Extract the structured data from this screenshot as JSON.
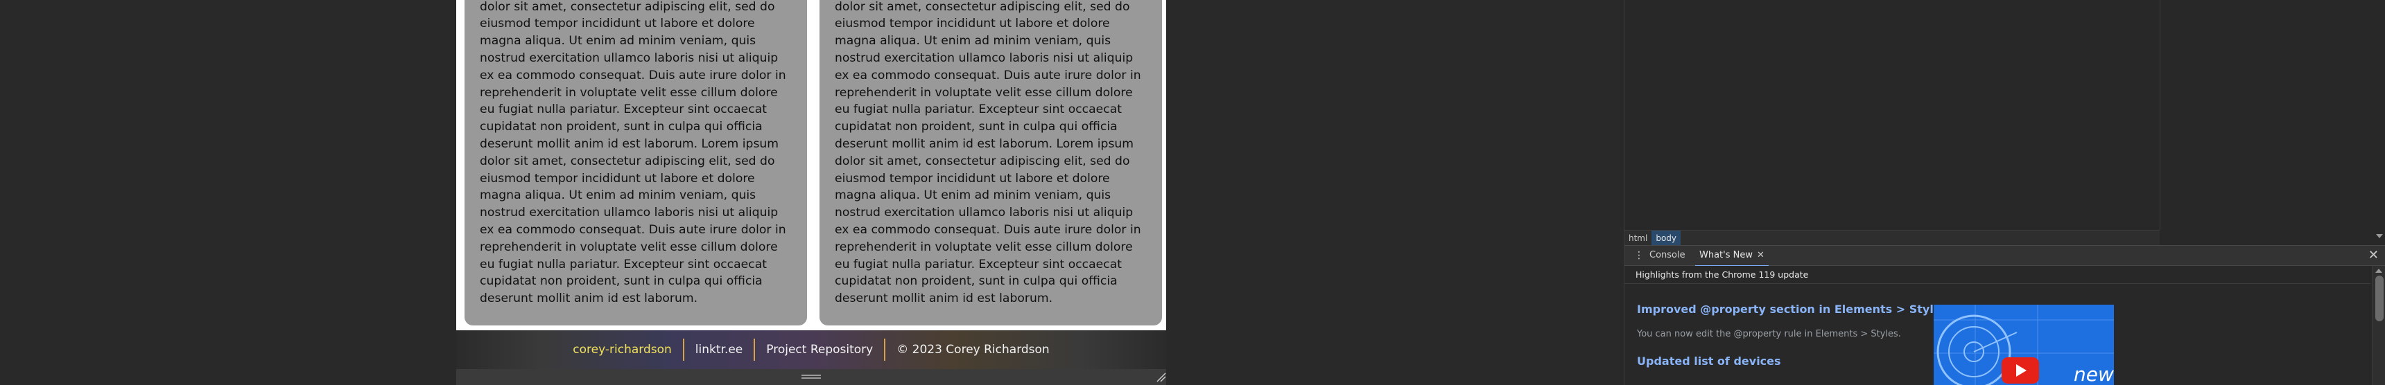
{
  "card_text": "cupidatat non proident, sunt in culpa qui officia deserunt mollit anim id est laborum. Lorem ipsum dolor sit amet, consectetur adipiscing elit, sed do eiusmod tempor incididunt ut labore et dolore magna aliqua. Ut enim ad minim veniam, quis nostrud exercitation ullamco laboris nisi ut aliquip ex ea commodo consequat. Duis aute irure dolor in reprehenderit in voluptate velit esse cillum dolore eu fugiat nulla pariatur. Excepteur sint occaecat cupidatat non proident, sunt in culpa qui officia deserunt mollit anim id est laborum. Lorem ipsum dolor sit amet, consectetur adipiscing elit, sed do eiusmod tempor incididunt ut labore et dolore magna aliqua. Ut enim ad minim veniam, quis nostrud exercitation ullamco laboris nisi ut aliquip ex ea commodo consequat. Duis aute irure dolor in reprehenderit in voluptate velit esse cillum dolore eu fugiat nulla pariatur. Excepteur sint occaecat cupidatat non proident, sunt in culpa qui officia deserunt mollit anim id est laborum.",
  "footer": {
    "author": "corey-richardson",
    "linktree": "linktr.ee",
    "repo": "Project Repository",
    "copyright": "© 2023 Corey Richardson"
  },
  "devtools": {
    "breadcrumbs": [
      "html",
      "body"
    ],
    "drawer_tabs": {
      "console": "Console",
      "whats_new": "What's New"
    },
    "whats_new": {
      "header": "Highlights from the Chrome 119 update",
      "heading1": "Improved @property section in Elements > Styles",
      "paragraph": "You can now edit the @property rule in Elements > Styles.",
      "heading2": "Updated list of devices",
      "thumbnail_word": "new"
    }
  },
  "icons": {
    "resize": "resize-corner-icon",
    "kebab": "more-vertical-icon",
    "close": "close-icon",
    "play": "youtube-play-icon"
  },
  "colors": {
    "card_bg": "#999999",
    "footer_highlight": "#f2e15a",
    "footer_separator": "#d6a24a",
    "devtools_link": "#8ab4f8",
    "thumbnail_bg": "#1e6fe0"
  }
}
